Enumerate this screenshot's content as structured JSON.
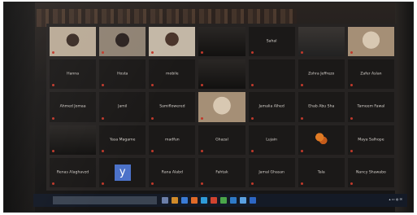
{
  "participants": [
    {
      "name": "",
      "video": "v1"
    },
    {
      "name": "",
      "video": "v2"
    },
    {
      "name": "",
      "video": "v3"
    },
    {
      "name": "",
      "video": "v4"
    },
    {
      "name": "Sahal",
      "video": ""
    },
    {
      "name": "",
      "video": "v6"
    },
    {
      "name": "",
      "video": "v5"
    },
    {
      "name": "Hanna",
      "video": ""
    },
    {
      "name": "Hosta",
      "video": ""
    },
    {
      "name": "mobile",
      "video": ""
    },
    {
      "name": "",
      "video": "v4"
    },
    {
      "name": "",
      "video": ""
    },
    {
      "name": "Zohra Jeffrezo",
      "video": ""
    },
    {
      "name": "Zafer Aslan",
      "video": ""
    },
    {
      "name": "Ahmed Jomaa",
      "video": ""
    },
    {
      "name": "Jamil",
      "video": ""
    },
    {
      "name": "Samiflowered",
      "video": ""
    },
    {
      "name": "",
      "video": "v5"
    },
    {
      "name": "Jamalia Alhed",
      "video": ""
    },
    {
      "name": "Ehab Abu Sha",
      "video": ""
    },
    {
      "name": "Tameem Fawal",
      "video": ""
    },
    {
      "name": "",
      "video": "v4"
    },
    {
      "name": "Yasa Magame",
      "video": ""
    },
    {
      "name": "madfun",
      "video": ""
    },
    {
      "name": "Ghazal",
      "video": ""
    },
    {
      "name": "Lujain",
      "video": ""
    },
    {
      "name": "",
      "video": "art"
    },
    {
      "name": "Maya Salhope",
      "video": ""
    },
    {
      "name": "Renas Alaghavzd",
      "video": ""
    },
    {
      "name": "",
      "video": "y"
    },
    {
      "name": "Rana Alabd",
      "video": ""
    },
    {
      "name": "Fahtak",
      "video": ""
    },
    {
      "name": "Jamal Ghasan",
      "video": ""
    },
    {
      "name": "Tala",
      "video": ""
    },
    {
      "name": "Nancy Shawabo",
      "video": ""
    }
  ],
  "avatar_letter": "y",
  "highlight_index": 6
}
